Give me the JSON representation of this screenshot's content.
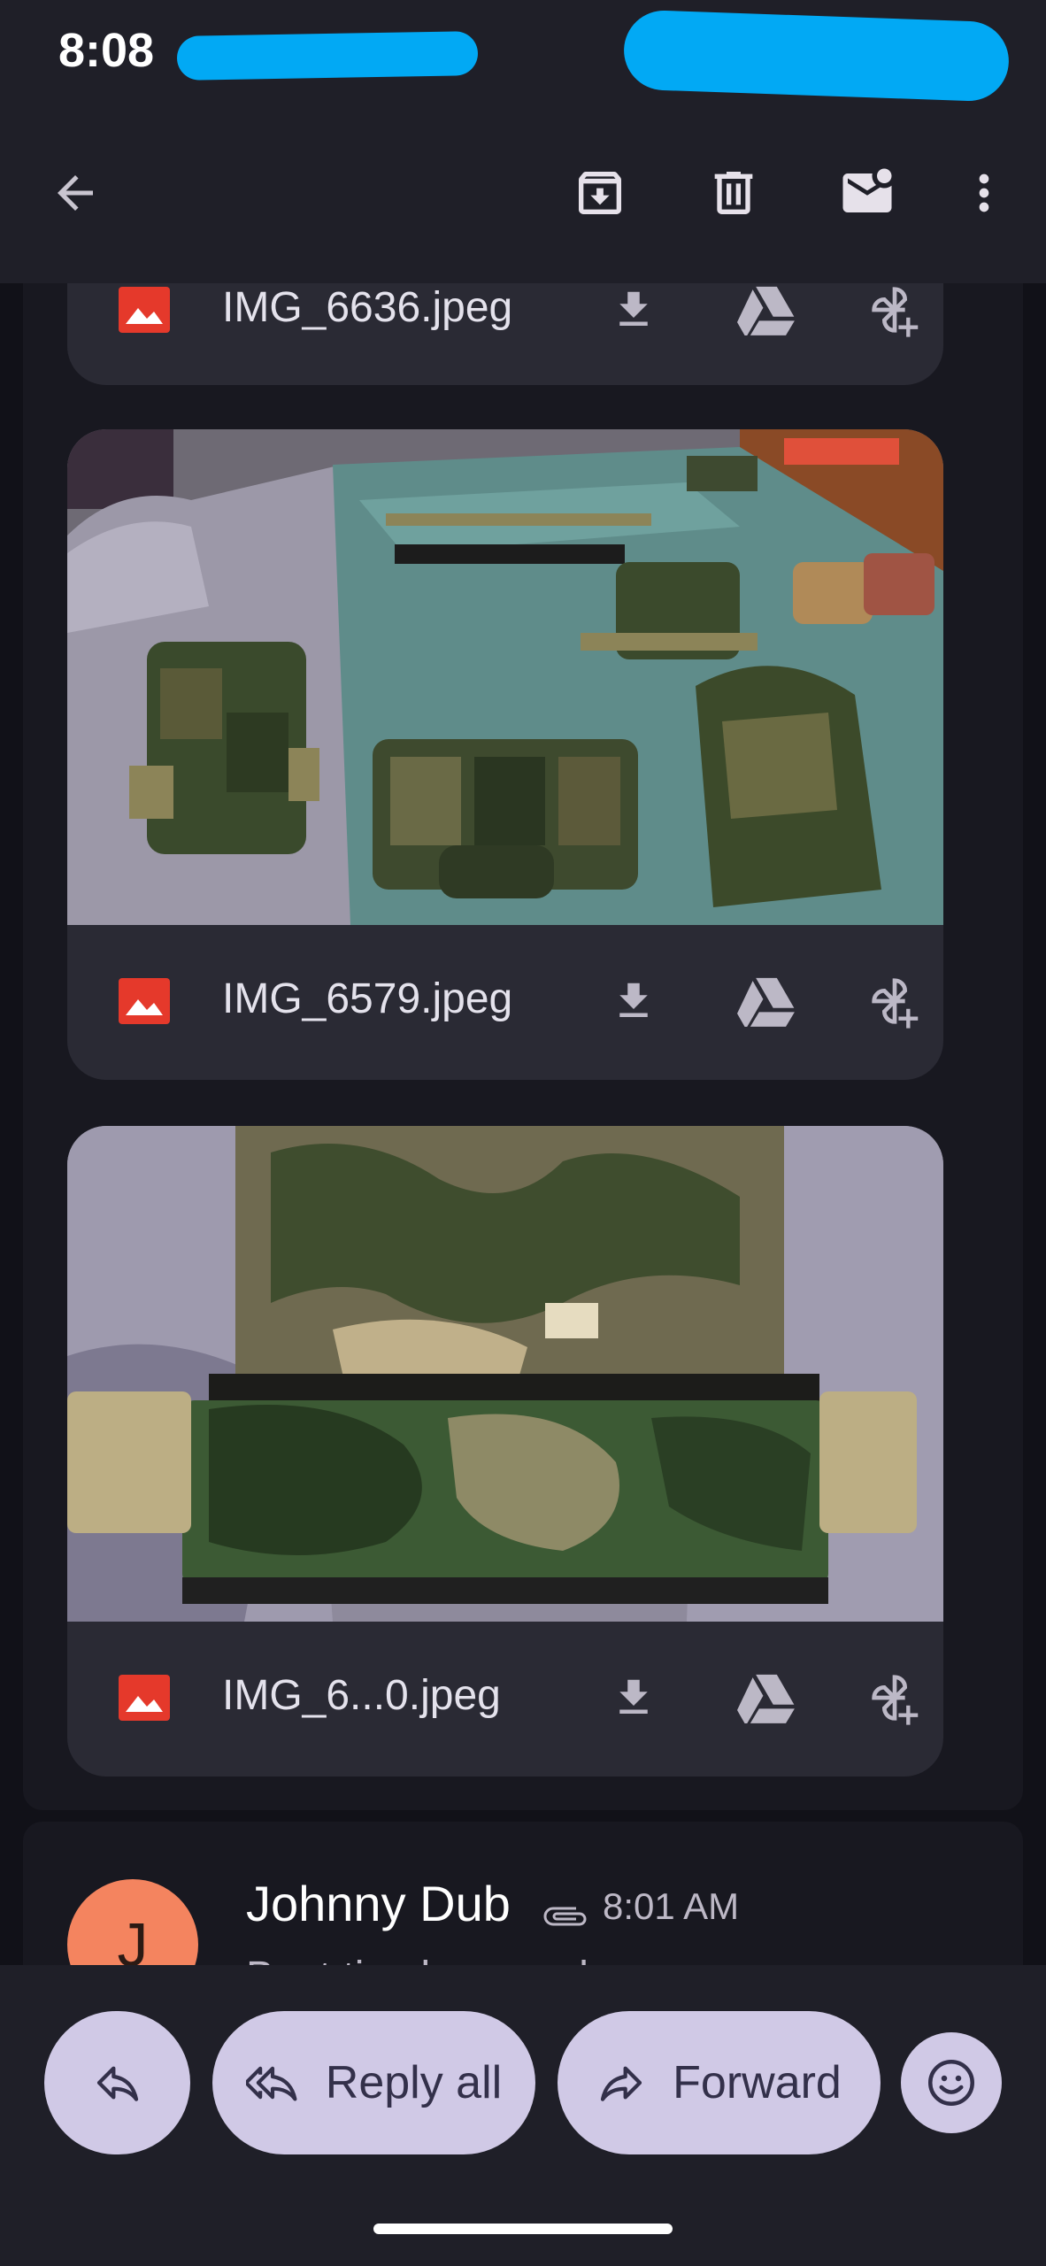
{
  "status_bar": {
    "time": "8:08"
  },
  "attachments": [
    {
      "filename": "IMG_6636.jpeg"
    },
    {
      "filename": "IMG_6579.jpeg"
    },
    {
      "filename": "IMG_6...0.jpeg"
    }
  ],
  "next_message": {
    "avatar_initial": "J",
    "sender": "Johnny Dub",
    "time": "8:01 AM",
    "snippet": "Best tips here and ……"
  },
  "actions": {
    "reply_all_label": "Reply all",
    "forward_label": "Forward"
  },
  "colors": {
    "background": "#111118",
    "bar": "#1f1f28",
    "card": "#2a2a34",
    "pill": "#d0c9e6",
    "image_icon": "#e5392b",
    "avatar": "#f4845f",
    "redaction": "#02a9f4"
  },
  "icons": [
    "back-arrow-icon",
    "archive-icon",
    "delete-icon",
    "mark-unread-icon",
    "more-vert-icon",
    "image-file-icon",
    "download-icon",
    "drive-icon",
    "add-to-photos-icon",
    "attachment-clip-icon",
    "reply-icon",
    "reply-all-icon",
    "forward-icon",
    "emoji-icon"
  ]
}
